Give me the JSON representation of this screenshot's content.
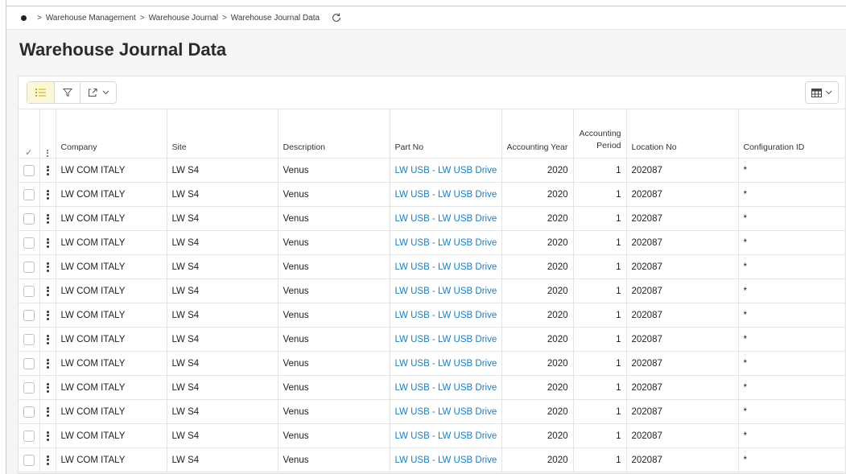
{
  "breadcrumb": {
    "items": [
      "Warehouse Management",
      "Warehouse Journal",
      "Warehouse Journal Data"
    ]
  },
  "page": {
    "title": "Warehouse Journal Data"
  },
  "toolbar": {
    "icons": [
      "list-icon",
      "filter-icon",
      "export-icon",
      "chevron-down-icon",
      "table-columns-icon"
    ]
  },
  "table": {
    "headers": {
      "company": "Company",
      "site": "Site",
      "description": "Description",
      "part_no": "Part No",
      "accounting_year": "Accounting Year",
      "accounting_period_line1": "Accounting",
      "accounting_period_line2": "Period",
      "location_no": "Location No",
      "configuration_id": "Configuration ID"
    },
    "rows": [
      {
        "company": "LW COM ITALY",
        "site": "LW S4",
        "description": "Venus",
        "part_no": "LW USB - LW USB Drive",
        "accounting_year": "2020",
        "accounting_period": "1",
        "location_no": "202087",
        "configuration_id": "*"
      },
      {
        "company": "LW COM ITALY",
        "site": "LW S4",
        "description": "Venus",
        "part_no": "LW USB - LW USB Drive",
        "accounting_year": "2020",
        "accounting_period": "1",
        "location_no": "202087",
        "configuration_id": "*"
      },
      {
        "company": "LW COM ITALY",
        "site": "LW S4",
        "description": "Venus",
        "part_no": "LW USB - LW USB Drive",
        "accounting_year": "2020",
        "accounting_period": "1",
        "location_no": "202087",
        "configuration_id": "*"
      },
      {
        "company": "LW COM ITALY",
        "site": "LW S4",
        "description": "Venus",
        "part_no": "LW USB - LW USB Drive",
        "accounting_year": "2020",
        "accounting_period": "1",
        "location_no": "202087",
        "configuration_id": "*"
      },
      {
        "company": "LW COM ITALY",
        "site": "LW S4",
        "description": "Venus",
        "part_no": "LW USB - LW USB Drive",
        "accounting_year": "2020",
        "accounting_period": "1",
        "location_no": "202087",
        "configuration_id": "*"
      },
      {
        "company": "LW COM ITALY",
        "site": "LW S4",
        "description": "Venus",
        "part_no": "LW USB - LW USB Drive",
        "accounting_year": "2020",
        "accounting_period": "1",
        "location_no": "202087",
        "configuration_id": "*"
      },
      {
        "company": "LW COM ITALY",
        "site": "LW S4",
        "description": "Venus",
        "part_no": "LW USB - LW USB Drive",
        "accounting_year": "2020",
        "accounting_period": "1",
        "location_no": "202087",
        "configuration_id": "*"
      },
      {
        "company": "LW COM ITALY",
        "site": "LW S4",
        "description": "Venus",
        "part_no": "LW USB - LW USB Drive",
        "accounting_year": "2020",
        "accounting_period": "1",
        "location_no": "202087",
        "configuration_id": "*"
      },
      {
        "company": "LW COM ITALY",
        "site": "LW S4",
        "description": "Venus",
        "part_no": "LW USB - LW USB Drive",
        "accounting_year": "2020",
        "accounting_period": "1",
        "location_no": "202087",
        "configuration_id": "*"
      },
      {
        "company": "LW COM ITALY",
        "site": "LW S4",
        "description": "Venus",
        "part_no": "LW USB - LW USB Drive",
        "accounting_year": "2020",
        "accounting_period": "1",
        "location_no": "202087",
        "configuration_id": "*"
      },
      {
        "company": "LW COM ITALY",
        "site": "LW S4",
        "description": "Venus",
        "part_no": "LW USB - LW USB Drive",
        "accounting_year": "2020",
        "accounting_period": "1",
        "location_no": "202087",
        "configuration_id": "*"
      },
      {
        "company": "LW COM ITALY",
        "site": "LW S4",
        "description": "Venus",
        "part_no": "LW USB - LW USB Drive",
        "accounting_year": "2020",
        "accounting_period": "1",
        "location_no": "202087",
        "configuration_id": "*"
      },
      {
        "company": "LW COM ITALY",
        "site": "LW S4",
        "description": "Venus",
        "part_no": "LW USB - LW USB Drive",
        "accounting_year": "2020",
        "accounting_period": "1",
        "location_no": "202087",
        "configuration_id": "*"
      }
    ]
  },
  "colors": {
    "link": "#1a7fc1",
    "active_toggle": "#fbf7d9",
    "panel_bg": "#f5f5f5"
  }
}
